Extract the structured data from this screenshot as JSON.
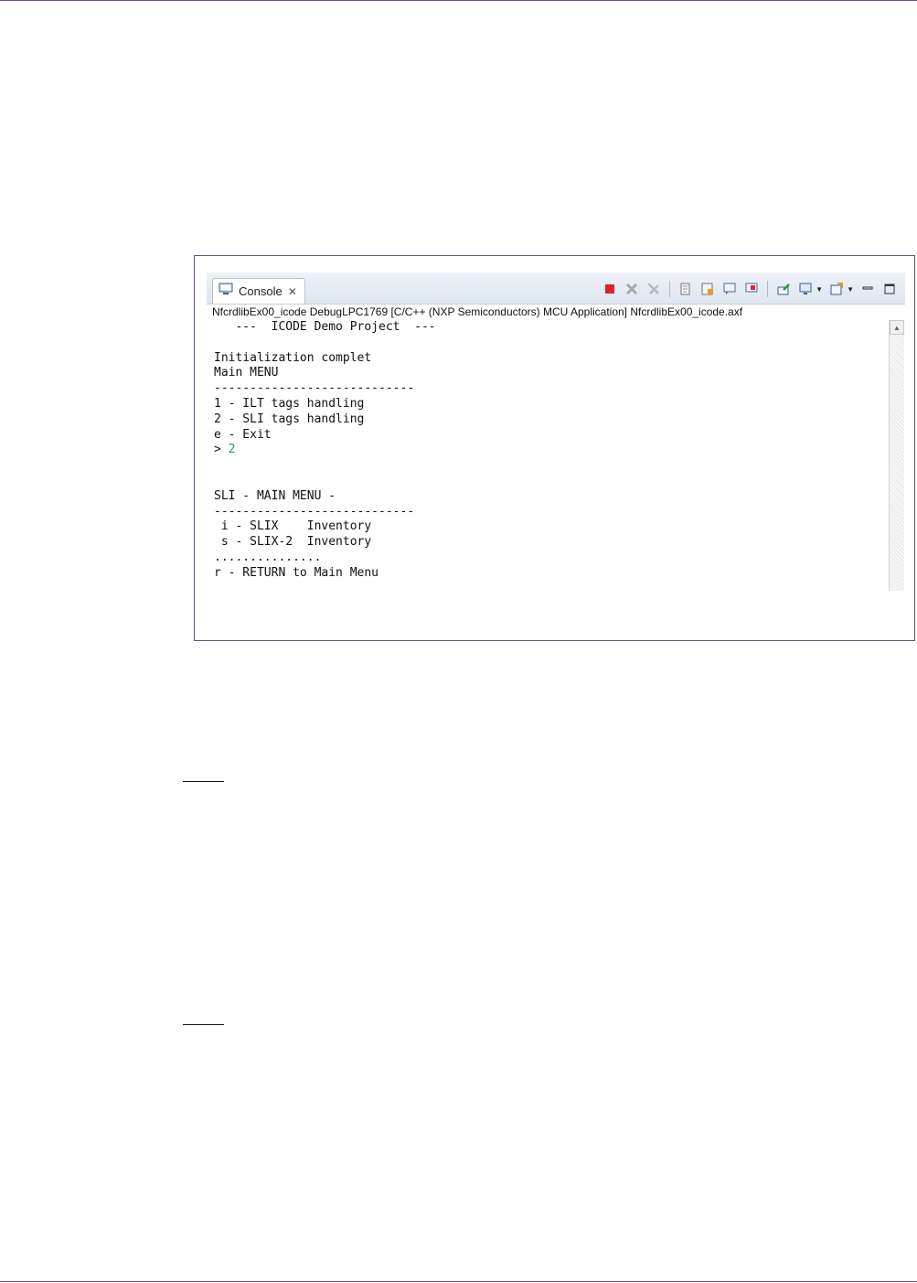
{
  "console": {
    "tab_label": "Console",
    "launch_info": "NfcrdlibEx00_icode DebugLPC1769 [C/C++ (NXP Semiconductors) MCU Application] NfcrdlibEx00_icode.axf",
    "lines": [
      "   ---  ICODE Demo Project  ---",
      "",
      "Initialization complet",
      "Main MENU",
      "----------------------------",
      "1 - ILT tags handling",
      "2 - SLI tags handling",
      "e - Exit",
      "> ",
      "",
      "",
      "SLI - MAIN MENU -",
      "----------------------------",
      " i - SLIX    Inventory",
      " s - SLIX-2  Inventory",
      "...............",
      "r - RETURN to Main Menu"
    ],
    "user_input": "2"
  },
  "icons": [
    "console-view-icon",
    "close-icon",
    "terminate-icon",
    "remove-launch-icon",
    "remove-all-terminated-icon",
    "clear-console-icon",
    "scroll-lock-icon",
    "show-on-stdout-icon",
    "show-on-stderr-icon",
    "pin-console-icon",
    "display-selected-console-icon",
    "open-console-icon",
    "minimize-icon",
    "maximize-icon"
  ],
  "colors": {
    "frame": "#6a4a96",
    "rule": "#6f4a9b",
    "input_text": "#1aa36e",
    "terminate": "#e0202a"
  }
}
